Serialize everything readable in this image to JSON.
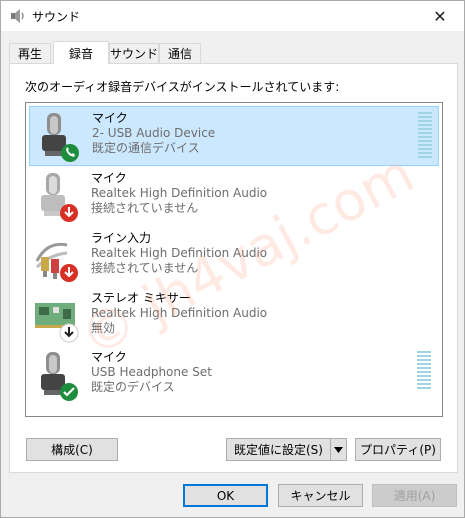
{
  "window": {
    "title": "サウンド",
    "close_symbol": "✕"
  },
  "tabs": [
    {
      "label": "再生",
      "active": false
    },
    {
      "label": "録音",
      "active": true
    },
    {
      "label": "サウンド",
      "active": false
    },
    {
      "label": "通信",
      "active": false
    }
  ],
  "panel": {
    "description": "次のオーディオ録音デバイスがインストールされています:"
  },
  "devices": [
    {
      "name": "マイク",
      "device": "2- USB Audio Device",
      "status": "既定の通信デバイス",
      "icon": "microphone-icon",
      "badge": "phone-icon",
      "badge_color": "#1e8e3e",
      "selected": true,
      "has_meter": true
    },
    {
      "name": "マイク",
      "device": "Realtek High Definition Audio",
      "status": "接続されていません",
      "icon": "microphone-icon",
      "badge": "down-arrow-icon",
      "badge_color": "#d93025",
      "selected": false,
      "has_meter": false
    },
    {
      "name": "ライン入力",
      "device": "Realtek High Definition Audio",
      "status": "接続されていません",
      "icon": "line-in-cable-icon",
      "badge": "down-arrow-icon",
      "badge_color": "#d93025",
      "selected": false,
      "has_meter": false
    },
    {
      "name": "ステレオ ミキサー",
      "device": "Realtek High Definition Audio",
      "status": "無効",
      "icon": "sound-card-icon",
      "badge": "down-arrow-icon",
      "badge_color": "#222222",
      "selected": false,
      "has_meter": false
    },
    {
      "name": "マイク",
      "device": "USB Headphone Set",
      "status": "既定のデバイス",
      "icon": "microphone-icon",
      "badge": "check-icon",
      "badge_color": "#1e8e3e",
      "selected": false,
      "has_meter": true
    }
  ],
  "buttons": {
    "configure": "構成(C)",
    "set_default": "既定値に設定(S)",
    "properties": "プロパティ(P)",
    "ok": "OK",
    "cancel": "キャンセル",
    "apply": "適用(A)"
  },
  "watermark": "© jh4vaj.com",
  "colors": {
    "selection": "#cce8ff",
    "selection_border": "#99d1ff",
    "meter": "#9fd4e4",
    "accent": "#0078d7"
  }
}
